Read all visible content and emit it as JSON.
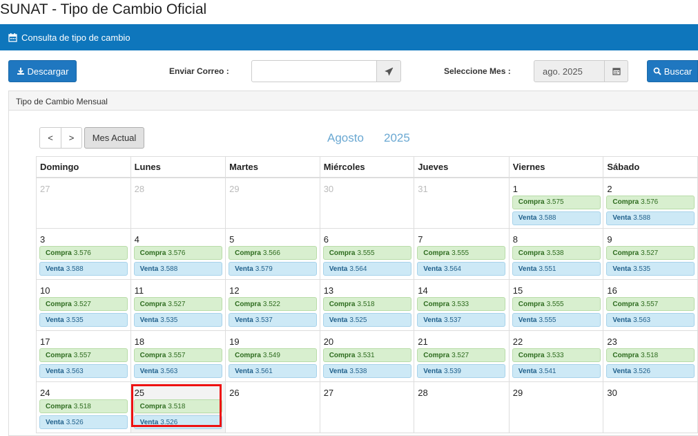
{
  "page": {
    "title": "SUNAT - Tipo de Cambio Oficial"
  },
  "topbar": {
    "title": "Consulta de tipo de cambio",
    "icon": "calendar-icon",
    "color": "#0e76bc"
  },
  "toolbar": {
    "download_label": "Descargar",
    "email_label": "Enviar Correo :",
    "email_value": "",
    "month_label": "Seleccione Mes :",
    "month_value": "ago. 2025",
    "search_label": "Buscar"
  },
  "panel": {
    "title": "Tipo de Cambio Mensual"
  },
  "calendar": {
    "prev_label": "<",
    "next_label": ">",
    "current_label": "Mes Actual",
    "month_name": "Agosto",
    "year": "2025",
    "compra_label": "Compra",
    "venta_label": "Venta",
    "days_of_week": [
      "Domingo",
      "Lunes",
      "Martes",
      "Miércoles",
      "Jueves",
      "Viernes",
      "Sábado"
    ],
    "weeks": [
      [
        {
          "day": "27",
          "muted": true
        },
        {
          "day": "28",
          "muted": true
        },
        {
          "day": "29",
          "muted": true
        },
        {
          "day": "30",
          "muted": true
        },
        {
          "day": "31",
          "muted": true
        },
        {
          "day": "1",
          "compra": "3.575",
          "venta": "3.588"
        },
        {
          "day": "2",
          "compra": "3.576",
          "venta": "3.588"
        }
      ],
      [
        {
          "day": "3",
          "compra": "3.576",
          "venta": "3.588"
        },
        {
          "day": "4",
          "compra": "3.576",
          "venta": "3.588"
        },
        {
          "day": "5",
          "compra": "3.566",
          "venta": "3.579"
        },
        {
          "day": "6",
          "compra": "3.555",
          "venta": "3.564"
        },
        {
          "day": "7",
          "compra": "3.555",
          "venta": "3.564"
        },
        {
          "day": "8",
          "compra": "3.538",
          "venta": "3.551"
        },
        {
          "day": "9",
          "compra": "3.527",
          "venta": "3.535"
        }
      ],
      [
        {
          "day": "10",
          "compra": "3.527",
          "venta": "3.535"
        },
        {
          "day": "11",
          "compra": "3.527",
          "venta": "3.535"
        },
        {
          "day": "12",
          "compra": "3.522",
          "venta": "3.537"
        },
        {
          "day": "13",
          "compra": "3.518",
          "venta": "3.525"
        },
        {
          "day": "14",
          "compra": "3.533",
          "venta": "3.537"
        },
        {
          "day": "15",
          "compra": "3.555",
          "venta": "3.555"
        },
        {
          "day": "16",
          "compra": "3.557",
          "venta": "3.563"
        }
      ],
      [
        {
          "day": "17",
          "compra": "3.557",
          "venta": "3.563"
        },
        {
          "day": "18",
          "compra": "3.557",
          "venta": "3.563"
        },
        {
          "day": "19",
          "compra": "3.549",
          "venta": "3.561"
        },
        {
          "day": "20",
          "compra": "3.531",
          "venta": "3.538"
        },
        {
          "day": "21",
          "compra": "3.527",
          "venta": "3.539"
        },
        {
          "day": "22",
          "compra": "3.533",
          "venta": "3.541"
        },
        {
          "day": "23",
          "compra": "3.518",
          "venta": "3.526"
        }
      ],
      [
        {
          "day": "24",
          "compra": "3.518",
          "venta": "3.526"
        },
        {
          "day": "25",
          "compra": "3.518",
          "venta": "3.526",
          "today": true,
          "highlighted": true
        },
        {
          "day": "26"
        },
        {
          "day": "27"
        },
        {
          "day": "28"
        },
        {
          "day": "29"
        },
        {
          "day": "30"
        }
      ]
    ]
  }
}
